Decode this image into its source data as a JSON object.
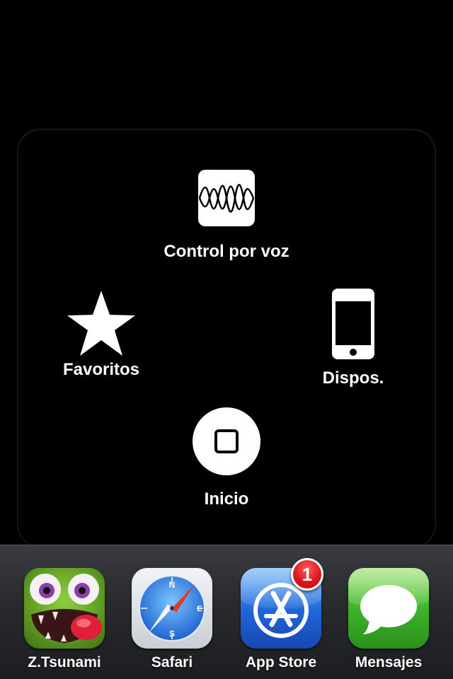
{
  "assistive_touch": {
    "voice_control": {
      "label": "Control por voz",
      "icon": "waveform-icon"
    },
    "favorites": {
      "label": "Favoritos",
      "icon": "star-icon"
    },
    "device": {
      "label": "Dispos.",
      "icon": "iphone-icon"
    },
    "home": {
      "label": "Inicio",
      "icon": "home-button-icon"
    }
  },
  "dock": {
    "apps": [
      {
        "label": "Z.Tsunami",
        "icon": "zombie-face-icon"
      },
      {
        "label": "Safari",
        "icon": "compass-icon"
      },
      {
        "label": "App Store",
        "icon": "app-store-icon",
        "badge": "1"
      },
      {
        "label": "Mensajes",
        "icon": "speech-bubble-icon"
      }
    ]
  },
  "colors": {
    "background": "#000000",
    "badge": "#d8151b",
    "messages_green": "#3fb42a",
    "safari_blue": "#2a7fe0",
    "appstore_blue": "#1f64d8",
    "zombie_green": "#6fae2c"
  }
}
